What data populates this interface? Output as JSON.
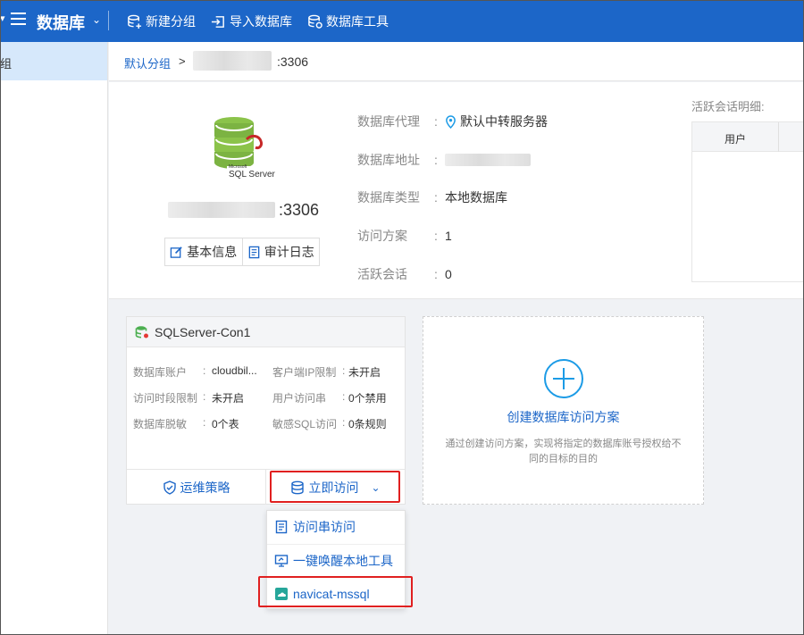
{
  "topbar": {
    "title": "数据库",
    "buttons": [
      {
        "label": "新建分组",
        "icon": "db-plus-icon"
      },
      {
        "label": "导入数据库",
        "icon": "import-icon"
      },
      {
        "label": "数据库工具",
        "icon": "db-tool-icon"
      }
    ]
  },
  "sidebar": {
    "active_item": "组"
  },
  "breadcrumb": {
    "group": "默认分组",
    "separator": ">",
    "port": ":3306"
  },
  "database": {
    "host_port": ":3306",
    "tabs": {
      "basic_info": "基本信息",
      "audit_log": "审计日志"
    },
    "fields": [
      {
        "label": "数据库代理",
        "value": "默认中转服务器"
      },
      {
        "label": "数据库地址",
        "value": ""
      },
      {
        "label": "数据库类型",
        "value": "本地数据库"
      },
      {
        "label": "访问方案",
        "value": "1"
      },
      {
        "label": "活跃会话",
        "value": "0"
      }
    ],
    "active_sessions": {
      "title": "活跃会话明细:",
      "column_user": "用户"
    }
  },
  "card": {
    "name": "SQLServer-Con1",
    "rows": [
      {
        "label": "数据库账户",
        "value": "cloudbil..."
      },
      {
        "label": "客户端IP限制",
        "value": "未开启"
      },
      {
        "label": "访问时段限制",
        "value": "未开启"
      },
      {
        "label": "用户访问串",
        "value": "0个禁用"
      },
      {
        "label": "数据库脱敏",
        "value": "0个表"
      },
      {
        "label": "敏感SQL访问",
        "value": "0条规则"
      }
    ],
    "colon": ":",
    "ops_label": "运维策略",
    "access_label": "立即访问"
  },
  "create": {
    "title": "创建数据库访问方案",
    "description": "通过创建访问方案，实现将指定的数据库账号授权给不同的目标的目的"
  },
  "dropdown": {
    "items": [
      "访问串访问",
      "一键唤醒本地工具",
      "navicat-mssql"
    ]
  },
  "colors": {
    "primary": "#1c66c8",
    "highlight": "#e02020"
  }
}
